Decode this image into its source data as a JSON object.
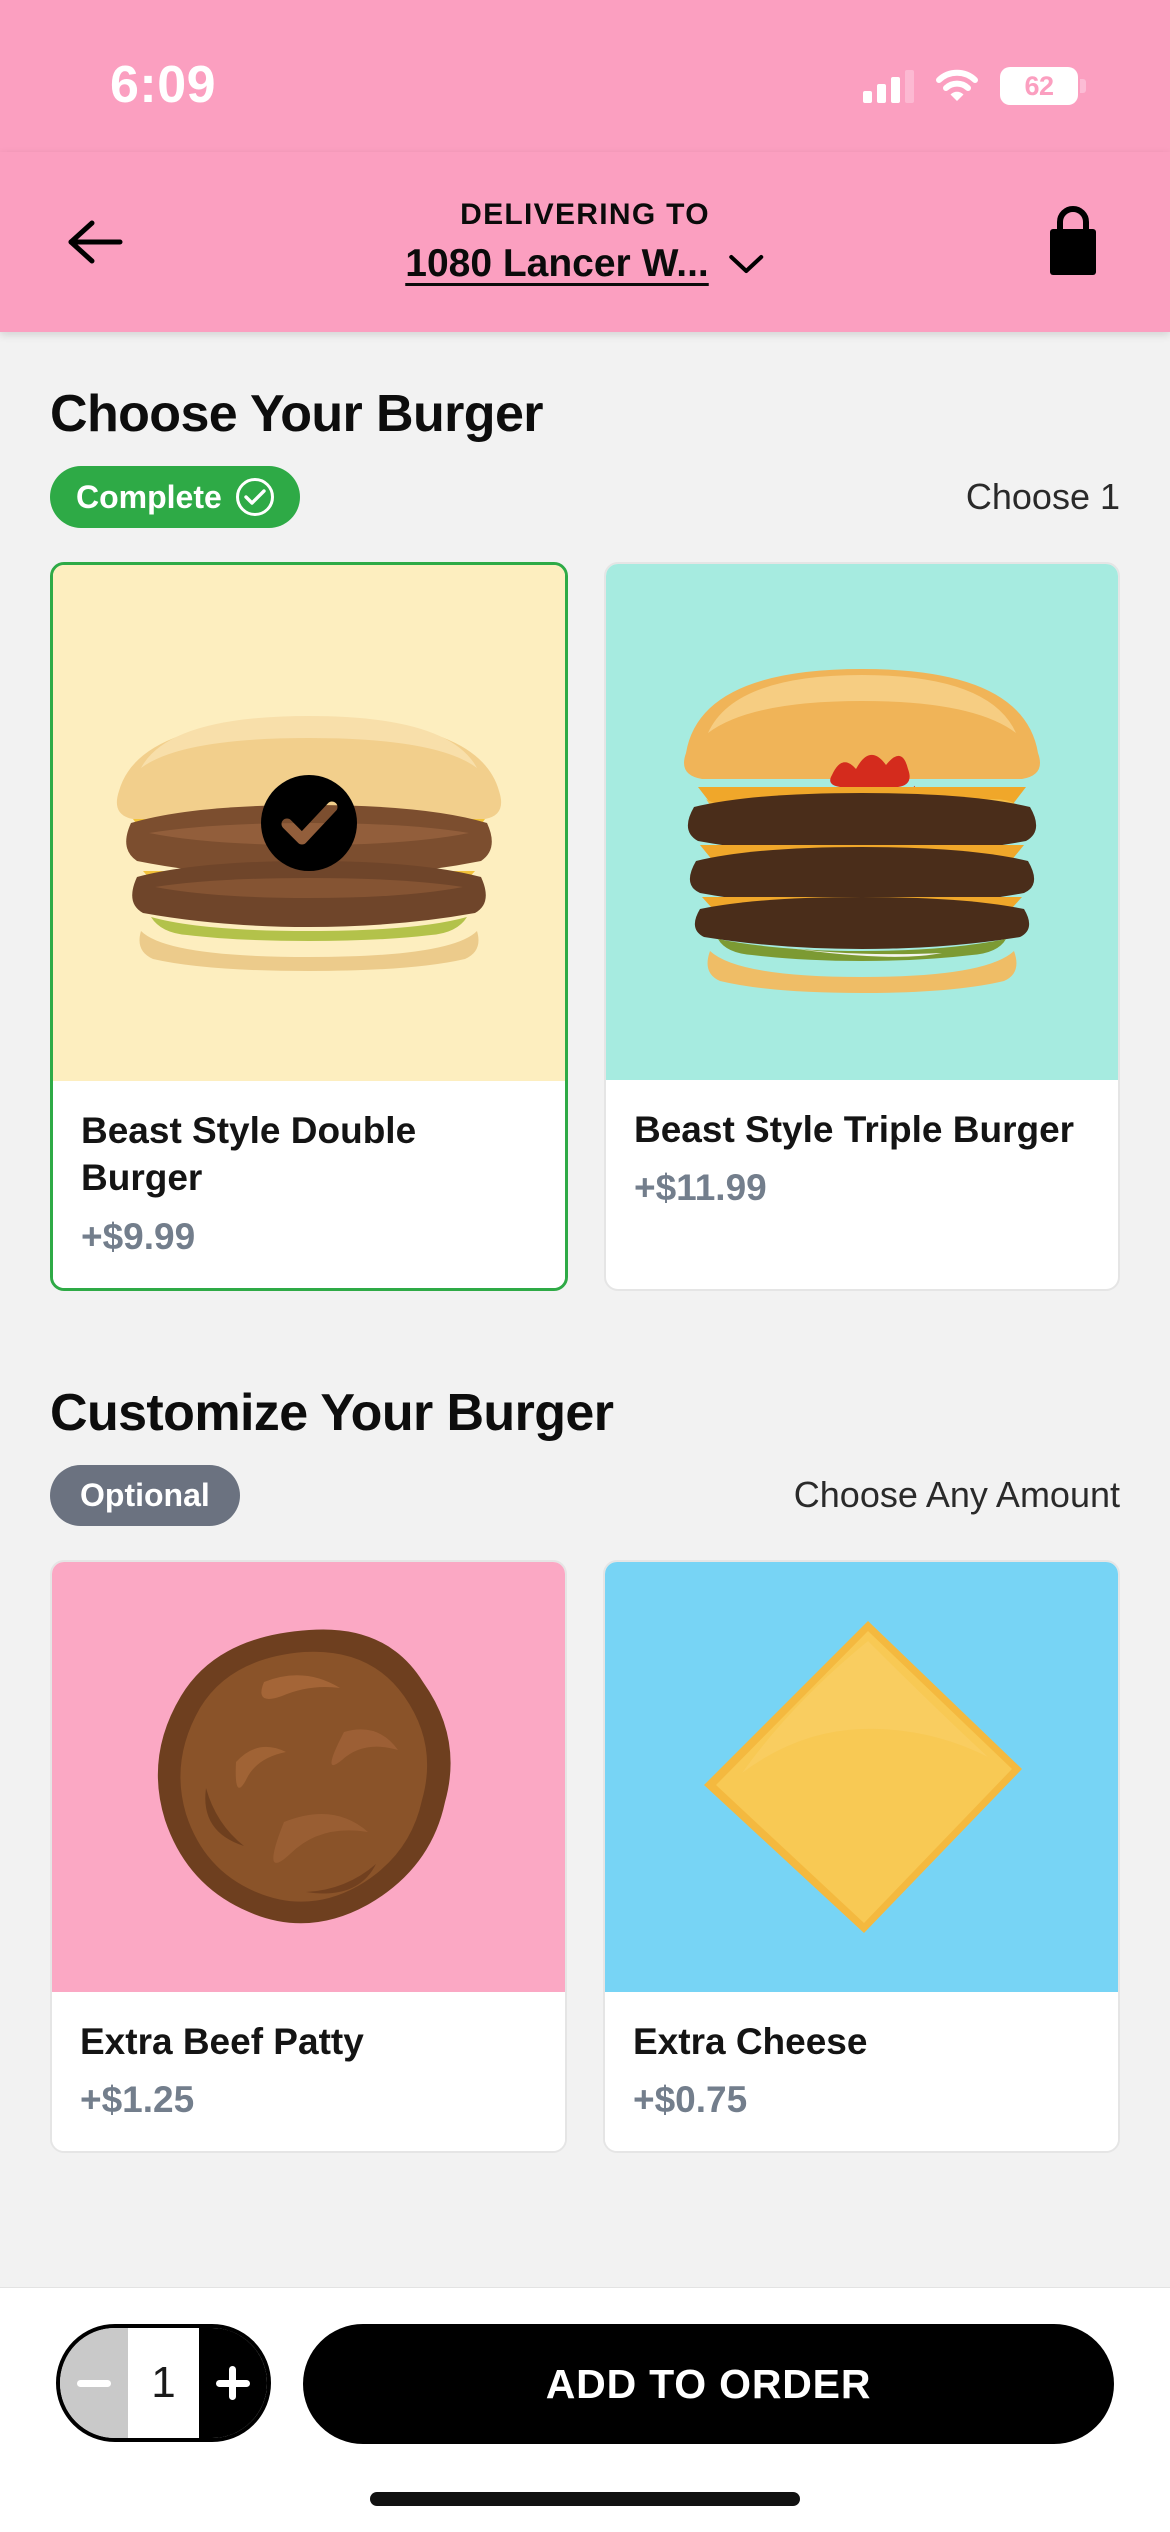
{
  "status_bar": {
    "time": "6:09",
    "battery_level": "62",
    "signal_icon": "cellular-signal-icon",
    "wifi_icon": "wifi-icon",
    "battery_icon": "battery-icon"
  },
  "header": {
    "back_icon": "back-arrow-icon",
    "delivering_label": "DELIVERING TO",
    "address": "1080 Lancer W...",
    "chevron_icon": "chevron-down-icon",
    "bag_icon": "shopping-bag-icon",
    "background_color": "#fb9fc0"
  },
  "sections": [
    {
      "title": "Choose Your Burger",
      "badge": {
        "label": "Complete",
        "icon": "check-circle-icon",
        "color": "#2eaa46"
      },
      "rule": "Choose 1",
      "options": [
        {
          "name": "Beast Style Double Burger",
          "price": "+$9.99",
          "selected": true,
          "image_name": "beast-style-double-burger-photo",
          "image_bg": "#fdeebf",
          "selected_icon": "checkmark-circle-icon"
        },
        {
          "name": "Beast Style Triple Burger",
          "price": "+$11.99",
          "selected": false,
          "image_name": "beast-style-triple-burger-photo",
          "image_bg": "#a6ebe0"
        }
      ]
    },
    {
      "title": "Customize Your Burger",
      "badge": {
        "label": "Optional",
        "icon": "",
        "color": "#6b7280"
      },
      "rule": "Choose Any Amount",
      "options": [
        {
          "name": "Extra Beef Patty",
          "price": "+$1.25",
          "selected": false,
          "image_name": "extra-beef-patty-photo",
          "image_bg": "#fba8c4"
        },
        {
          "name": "Extra Cheese",
          "price": "+$0.75",
          "selected": false,
          "image_name": "extra-cheese-photo",
          "image_bg": "#77d4f5"
        }
      ]
    }
  ],
  "bottom_bar": {
    "decrement_label": "-",
    "quantity": "1",
    "increment_label": "+",
    "add_to_order_label": "ADD TO ORDER"
  }
}
